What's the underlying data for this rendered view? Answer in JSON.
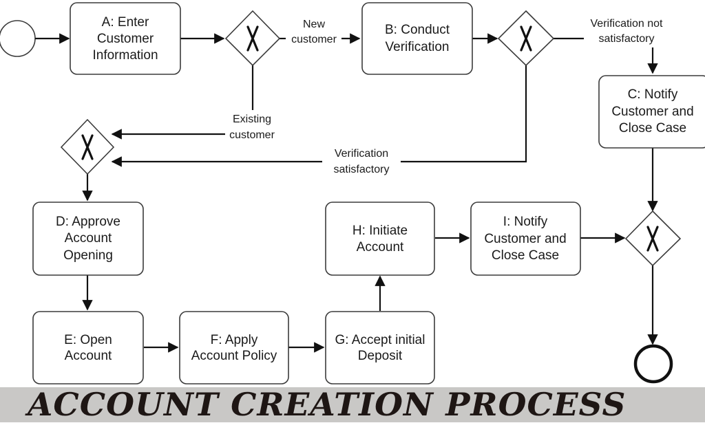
{
  "title": "ACCOUNT CREATION PROCESS",
  "tasks": {
    "A": [
      "A: Enter",
      "Customer",
      "Information"
    ],
    "B": [
      "B: Conduct",
      "Verification"
    ],
    "C": [
      "C: Notify",
      "Customer and",
      "Close Case"
    ],
    "D": [
      "D: Approve",
      "Account",
      "Opening"
    ],
    "E": [
      "E: Open",
      "Account"
    ],
    "F": [
      "F: Apply",
      "Account Policy"
    ],
    "G": [
      "G: Accept initial",
      "Deposit"
    ],
    "H": [
      "H: Initiate",
      "Account"
    ],
    "I": [
      "I: Notify",
      "Customer and",
      "Close Case"
    ]
  },
  "flow_labels": {
    "new_customer": [
      "New",
      "customer"
    ],
    "existing_customer": [
      "Existing",
      "customer"
    ],
    "verification_not_satisfactory": [
      "Verification not",
      "satisfactory"
    ],
    "verification_satisfactory": [
      "Verification",
      "satisfactory"
    ]
  },
  "gateways": {
    "type_symbol": "X",
    "count": 4,
    "kind": "exclusive-gateway"
  },
  "events": {
    "start": "start-event",
    "end": "end-event"
  }
}
